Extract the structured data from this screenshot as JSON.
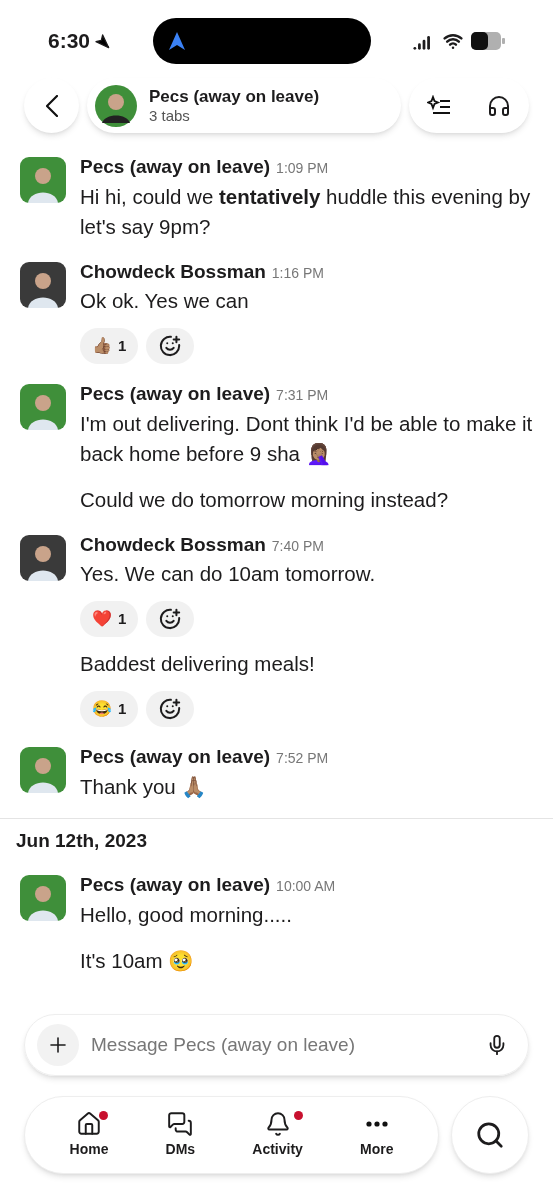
{
  "status_bar": {
    "time": "6:30"
  },
  "header": {
    "title": "Pecs (away on leave)",
    "subtitle": "3 tabs"
  },
  "feed": [
    {
      "kind": "message",
      "sender": "Pecs (away on leave)",
      "time": "1:09 PM",
      "color": "#3f8f3a",
      "paragraphs": [
        "Hi hi, could we **tentatively** huddle this evening by let's say 9pm?"
      ]
    },
    {
      "kind": "message",
      "sender": "Chowdeck Bossman",
      "time": "1:16 PM",
      "color": "#3a3a3a",
      "paragraphs": [
        "Ok ok. Yes we can"
      ],
      "reactions": [
        {
          "emoji": "👍🏽",
          "count": "1"
        }
      ]
    },
    {
      "kind": "message",
      "sender": "Pecs (away on leave)",
      "time": "7:31 PM",
      "color": "#3f8f3a",
      "paragraphs": [
        "I'm out delivering. Dont think I'd be able to make it back home before 9 sha 🤦🏽‍♀️",
        "Could we do tomorrow morning instead?"
      ]
    },
    {
      "kind": "message",
      "sender": "Chowdeck Bossman",
      "time": "7:40 PM",
      "color": "#3a3a3a",
      "paragraphs": [
        "Yes. We can do 10am tomorrow."
      ],
      "reactions": [
        {
          "emoji": "❤️",
          "count": "1"
        }
      ]
    },
    {
      "kind": "continuation",
      "paragraphs": [
        "Baddest delivering meals!"
      ],
      "reactions": [
        {
          "emoji": "😂",
          "count": "1"
        }
      ]
    },
    {
      "kind": "message",
      "sender": "Pecs (away on leave)",
      "time": "7:52 PM",
      "color": "#3f8f3a",
      "paragraphs": [
        "Thank you 🙏🏽"
      ]
    },
    {
      "kind": "date",
      "label": "Jun 12th, 2023"
    },
    {
      "kind": "message",
      "sender": "Pecs (away on leave)",
      "time": "10:00 AM",
      "color": "#3f8f3a",
      "paragraphs": [
        "Hello, good morning.....",
        "It's 10am 🥹"
      ]
    }
  ],
  "composer": {
    "placeholder": "Message Pecs (away on leave)"
  },
  "nav": [
    {
      "label": "Home",
      "badge": true
    },
    {
      "label": "DMs",
      "badge": false
    },
    {
      "label": "Activity",
      "badge": true
    },
    {
      "label": "More",
      "badge": false
    }
  ]
}
